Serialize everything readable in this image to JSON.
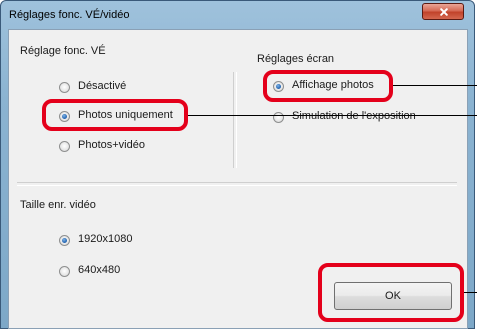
{
  "window": {
    "title": "Réglages fonc. VÉ/vidéo"
  },
  "live_view": {
    "heading": "Réglage fonc. VÉ",
    "options": [
      {
        "label": "Désactivé",
        "selected": false
      },
      {
        "label": "Photos uniquement",
        "selected": true
      },
      {
        "label": "Photos+vidéo",
        "selected": false
      }
    ]
  },
  "screen": {
    "heading": "Réglages écran",
    "options": [
      {
        "label": "Affichage photos",
        "selected": true
      },
      {
        "label": "Simulation de l'exposition",
        "selected": false
      }
    ]
  },
  "video_size": {
    "heading": "Taille enr. vidéo",
    "options": [
      {
        "label": "1920x1080",
        "selected": true
      },
      {
        "label": "640x480",
        "selected": false
      }
    ]
  },
  "buttons": {
    "ok_label": "OK"
  },
  "colors": {
    "highlight": "#e4001b",
    "title_bar": "#8bb3d1",
    "close_button": "#c1432b"
  }
}
